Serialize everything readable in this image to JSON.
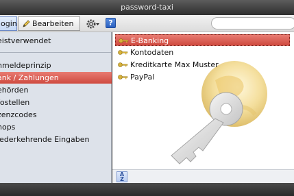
{
  "window": {
    "title": "password-taxi"
  },
  "toolbar": {
    "login_label": "ogin",
    "edit_label": "Bearbeiten",
    "gear_icon": "gear-icon",
    "help_label": "?"
  },
  "sidebar": {
    "items": [
      {
        "label": "eistverwendet",
        "selected": false
      },
      {
        "label": "nmeldeprinzip",
        "selected": false
      },
      {
        "label": "ank / Zahlungen",
        "selected": true
      },
      {
        "label": "ehörden",
        "selected": false
      },
      {
        "label": "fostellen",
        "selected": false
      },
      {
        "label": "zenzcodes",
        "selected": false
      },
      {
        "label": "hops",
        "selected": false
      },
      {
        "label": "iederkehrende Eingaben",
        "selected": false
      }
    ]
  },
  "main": {
    "entries": [
      {
        "label": "E-Banking",
        "selected": true
      },
      {
        "label": "Kontodaten",
        "selected": false
      },
      {
        "label": "Kreditkarte Max Muster",
        "selected": false
      },
      {
        "label": "PayPal",
        "selected": false
      }
    ]
  },
  "status": {
    "sort_top": "A",
    "sort_bottom": "Z"
  },
  "colors": {
    "selection": "#d9584d",
    "sidebar_bg": "#dde2ea",
    "titlebar": "#3a3a3a",
    "key_gold": "#d8b23a"
  }
}
